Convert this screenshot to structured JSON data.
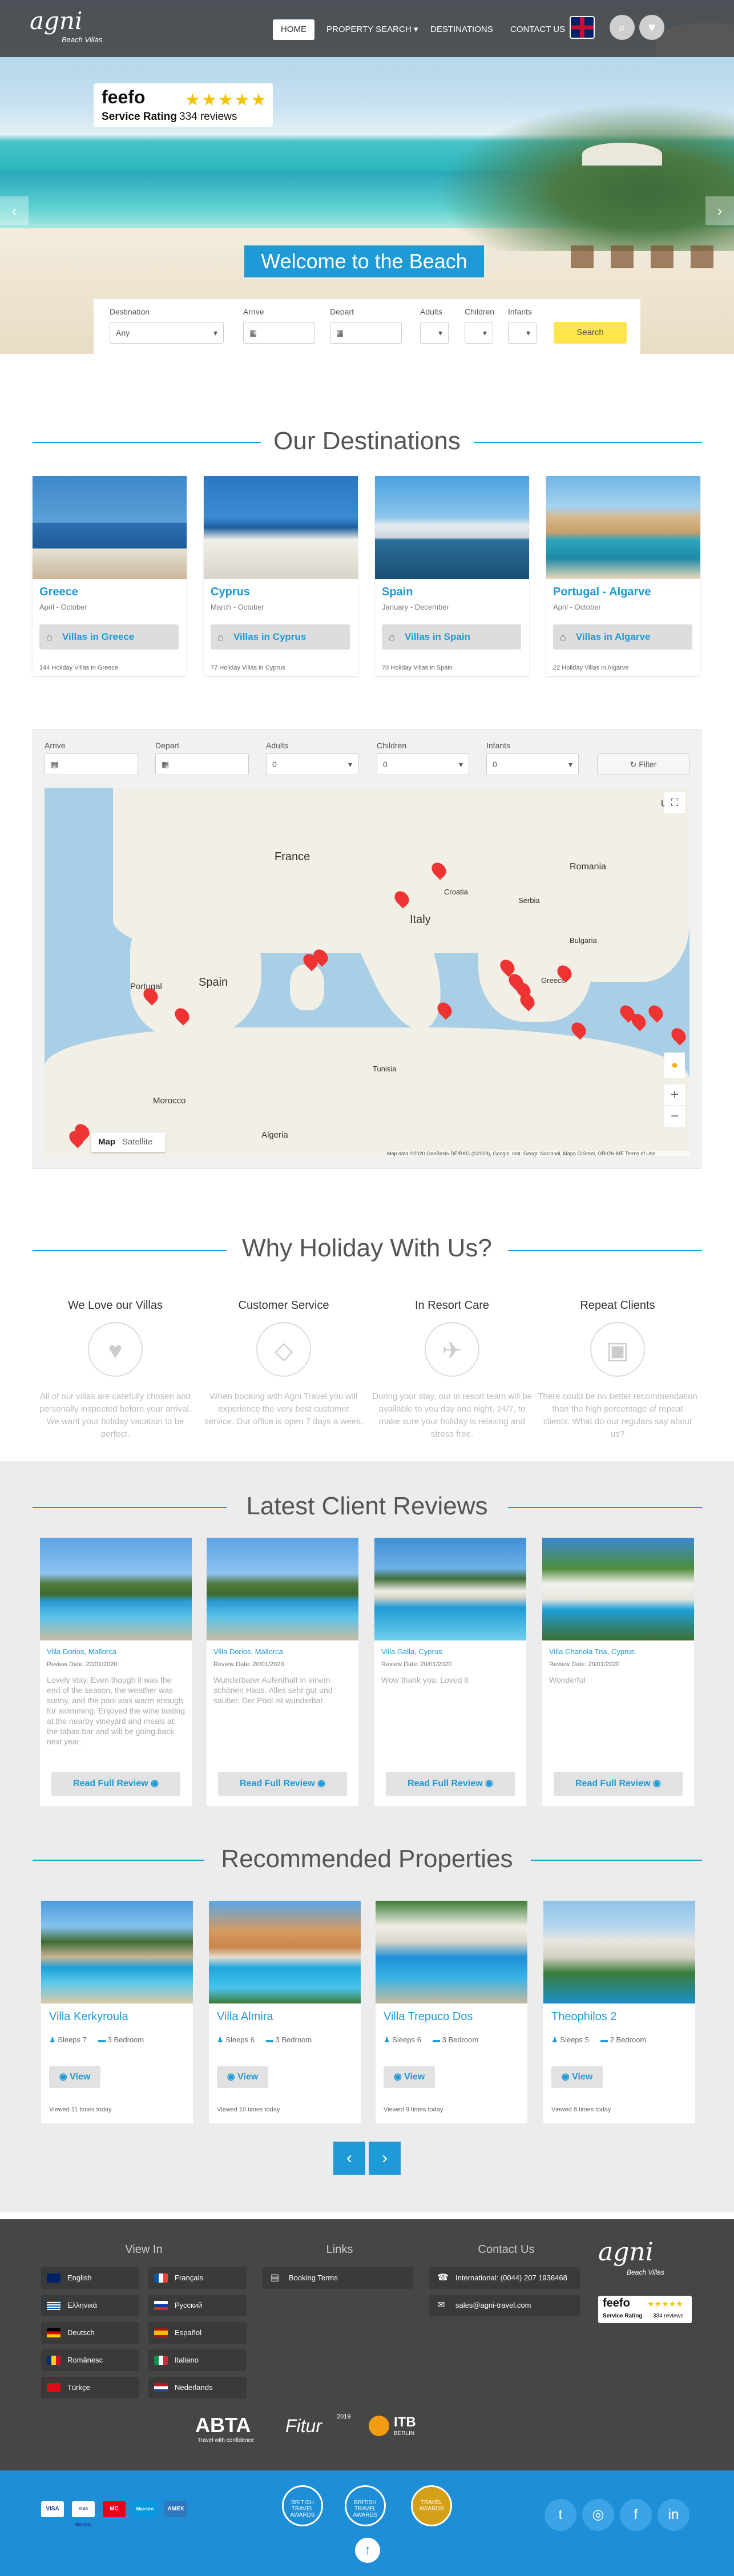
{
  "brand": {
    "logo": "agni",
    "logo_sub": "Beach Villas"
  },
  "nav": {
    "items": [
      "HOME",
      "PROPERTY SEARCH ▾",
      "DESTINATIONS",
      "CONTACT US"
    ]
  },
  "feefo": {
    "logo": "feefo",
    "rating_label": "Service Rating",
    "reviews": "334 reviews",
    "stars": "★★★★★"
  },
  "hero": {
    "welcome": "Welcome to the Beach"
  },
  "search": {
    "labels": {
      "destination": "Destination",
      "arrive": "Arrive",
      "depart": "Depart",
      "adults": "Adults",
      "children": "Children",
      "infants": "Infants"
    },
    "destination_value": "Any",
    "button": "Search"
  },
  "destinations": {
    "title": "Our Destinations",
    "items": [
      {
        "name": "Greece",
        "season": "April - October",
        "button": "Villas in Greece",
        "count": "144 Holiday Villas in Greece"
      },
      {
        "name": "Cyprus",
        "season": "March - October",
        "button": "Villas in Cyprus",
        "count": "77 Holiday Villas in Cyprus"
      },
      {
        "name": "Spain",
        "season": "January - December",
        "button": "Villas in Spain",
        "count": "70 Holiday Villas in Spain"
      },
      {
        "name": "Portugal - Algarve",
        "season": "April - October",
        "button": "Villas in Algarve",
        "count": "22 Holiday Villas in Algarve"
      }
    ]
  },
  "map_filter": {
    "labels": [
      "Arrive",
      "Depart",
      "Adults",
      "Children",
      "Infants"
    ],
    "select_value": "0",
    "button": "Filter",
    "map_tab": "Map",
    "satellite_tab": "Satellite",
    "countries": [
      "France",
      "Spain",
      "Portugal",
      "Italy",
      "Greece",
      "Romania",
      "Morocco",
      "Algeria",
      "Tunisia",
      "Croatia",
      "Serbia",
      "Bulgaria",
      "Ukr"
    ],
    "attribution": "Map data ©2020 GeoBasis-DE/BKG (©2009), Google, Inst. Geogr. Nacional, Mapa GISrael, ORION-ME   Terms of Use"
  },
  "why": {
    "title": "Why Holiday With Us?",
    "items": [
      {
        "head": "We Love our Villas",
        "icon": "heart-icon",
        "glyph": "♥",
        "text": "All of our villas are carefully chosen and personally inspected before your arrival. We want your holiday vacation to be perfect."
      },
      {
        "head": "Customer Service",
        "icon": "diamond-icon",
        "glyph": "◇",
        "text": "When booking with Agni Travel you will experience the very best customer service. Our office is open 7 days a week."
      },
      {
        "head": "In Resort Care",
        "icon": "plane-icon",
        "glyph": "✈",
        "text": "During your stay, our in resort team will be available to you day and night, 24/7, to make sure your holiday is relaxing and stress free."
      },
      {
        "head": "Repeat Clients",
        "icon": "suitcase-icon",
        "glyph": "▣",
        "text": "There could be no better recommendation than the high percentage of repeat clients. What do our regulars say about us?"
      }
    ]
  },
  "reviews": {
    "title": "Latest Client Reviews",
    "button": "Read Full Review",
    "items": [
      {
        "villa": "Villa Dorios, Mallorca",
        "date": "Review Date: 20/01/2020",
        "text": "Lovely stay. Even though it was the end of the season, the weather was sunny, and the pool was warm enough for swimming. Enjoyed the wine tasting at the nearby vineyard and meals at the tabas bar and will be going back next year."
      },
      {
        "villa": "Villa Dorios, Mallorca",
        "date": "Review Date: 20/01/2020",
        "text": "Wunderbarer Aufenthalt in einem schönen Haus. Alles sehr gut und sauber. Der Pool ist wunderbar."
      },
      {
        "villa": "Villa Galla, Cyprus",
        "date": "Review Date: 20/01/2020",
        "text": "Wow thank you. Loved it"
      },
      {
        "villa": "Villa Chariola Tria, Cyprus",
        "date": "Review Date: 20/01/2020",
        "text": "Wonderful"
      }
    ]
  },
  "properties": {
    "title": "Recommended Properties",
    "button": "View",
    "items": [
      {
        "name": "Villa Kerkyroula",
        "sleeps": "Sleeps 7",
        "bedrooms": "3 Bedroom",
        "viewed": "Viewed 11 times today"
      },
      {
        "name": "Villa Almira",
        "sleeps": "Sleeps 6",
        "bedrooms": "3 Bedroom",
        "viewed": "Viewed 10 times today"
      },
      {
        "name": "Villa Trepuco Dos",
        "sleeps": "Sleeps 6",
        "bedrooms": "3 Bedroom",
        "viewed": "Viewed 9 times today"
      },
      {
        "name": "Theophilos 2",
        "sleeps": "Sleeps 5",
        "bedrooms": "2 Bedroom",
        "viewed": "Viewed 8 times today"
      }
    ],
    "prev": "‹",
    "next": "›"
  },
  "footer": {
    "view_in": "View In",
    "links": "Links",
    "contact": "Contact Us",
    "languages": [
      "English",
      "Français",
      "Ελληνικά",
      "Русский",
      "Deutsch",
      "Español",
      "Românesc",
      "Italiano",
      "Türkçe",
      "Nederlands"
    ],
    "booking_terms": "Booking Terms",
    "phone": "International: (0044) 207 1936468",
    "email": "sales@agni-travel.com",
    "abta": "ABTA",
    "abta_sub": "Travel with confidence",
    "fitur": "Fitur",
    "fitur_year": "2019",
    "itb": "ITB",
    "itb_sub": "BERLIN",
    "feefo_small": "feefo",
    "feefo_small_label": "Service Rating",
    "feefo_small_reviews": "334 reviews"
  },
  "bottom": {
    "pay": [
      "VISA",
      "VISA Electron",
      "MC",
      "Maestro",
      "AMEX"
    ],
    "badges": [
      "BRITISH TRAVEL AWARDS",
      "BRITISH TRAVEL AWARDS",
      "TRAVEL AWARDS"
    ],
    "social": [
      "t",
      "◎",
      "f",
      "in"
    ],
    "top": "↑"
  },
  "colors": {
    "accent": "#1e9ad6",
    "footer": "#464646",
    "blue": "#1e8fd6",
    "search_button": "#fde64b"
  }
}
